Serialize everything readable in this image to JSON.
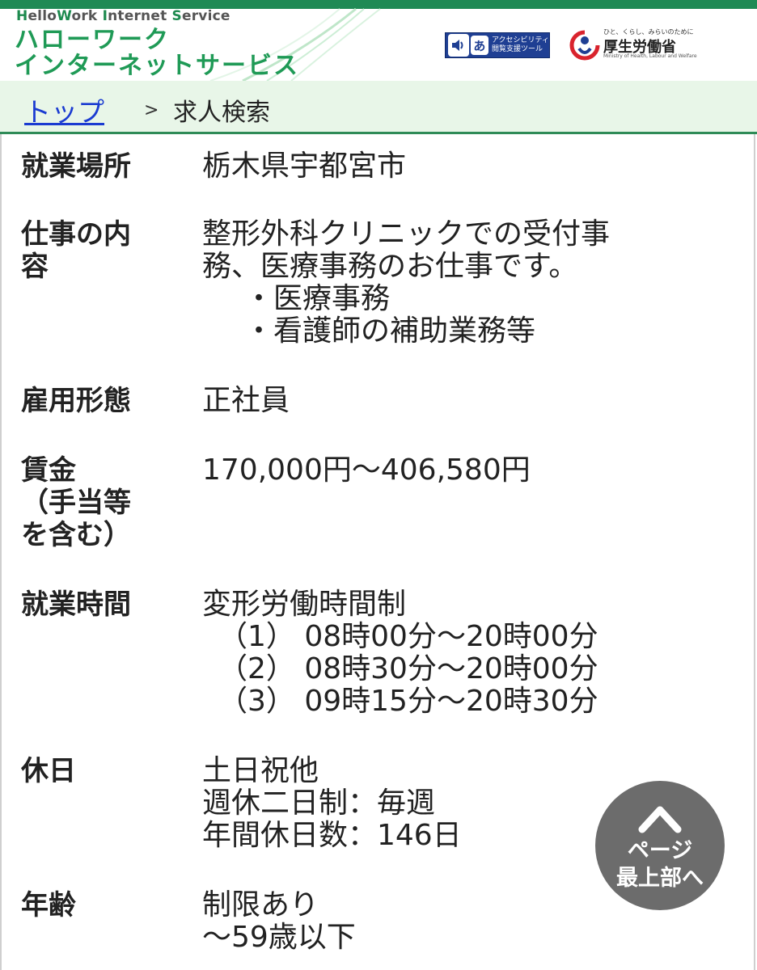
{
  "header": {
    "brand_en_parts": [
      "H",
      "ello",
      "W",
      "ork ",
      "I",
      "nternet ",
      "S",
      "ervice"
    ],
    "brand_ja_line1": "ハローワーク",
    "brand_ja_line2": "インターネットサービス",
    "accessibility_tool": {
      "icon_glyph": "あ",
      "line1": "アクセシビリティ",
      "line2": "閲覧支援ツール"
    },
    "ministry": {
      "tagline": "ひと、くらし、みらいのために",
      "name": "厚生労働省",
      "name_en": "Ministry of Health, Labour and Welfare"
    },
    "colors": {
      "brand_green": "#1f9a56",
      "bar_green": "#1f8a55",
      "a11y_blue": "#1f3f93"
    }
  },
  "breadcrumb": {
    "top_link": "トップ",
    "separator": ">",
    "current": "求人検索",
    "colors": {
      "background": "#e8f6e8",
      "link": "#1a3bd1"
    }
  },
  "details": [
    {
      "label_lines": [
        "就業場所"
      ],
      "value_lines": [
        "栃木県宇都宮市"
      ]
    },
    {
      "label_lines": [
        "仕事の内",
        "容"
      ],
      "value_lines": [
        "整形外科クリニックでの受付事",
        "務、医療事務のお仕事です。",
        "・医療事務",
        "・看護師の補助業務等"
      ]
    },
    {
      "label_lines": [
        "雇用形態"
      ],
      "value_lines": [
        "正社員"
      ]
    },
    {
      "label_lines": [
        "賃金",
        "（手当等",
        "を含む）"
      ],
      "value_lines": [
        "170,000円～406,580円"
      ]
    },
    {
      "label_lines": [
        "就業時間"
      ],
      "value_lines": [
        "変形労働時間制",
        "（1） 08時00分～20時00分",
        "（2） 08時30分～20時00分",
        "（3） 09時15分～20時30分"
      ]
    },
    {
      "label_lines": [
        "休日"
      ],
      "value_lines": [
        "土日祝他",
        "週休二日制：毎週",
        "年間休日数：146日"
      ]
    },
    {
      "label_lines": [
        "年齢"
      ],
      "value_lines": [
        "制限あり",
        "～59歳以下"
      ]
    }
  ],
  "scroll_top": {
    "icon": "chevron-up-icon",
    "line1": "ページ",
    "line2": "最上部へ"
  }
}
